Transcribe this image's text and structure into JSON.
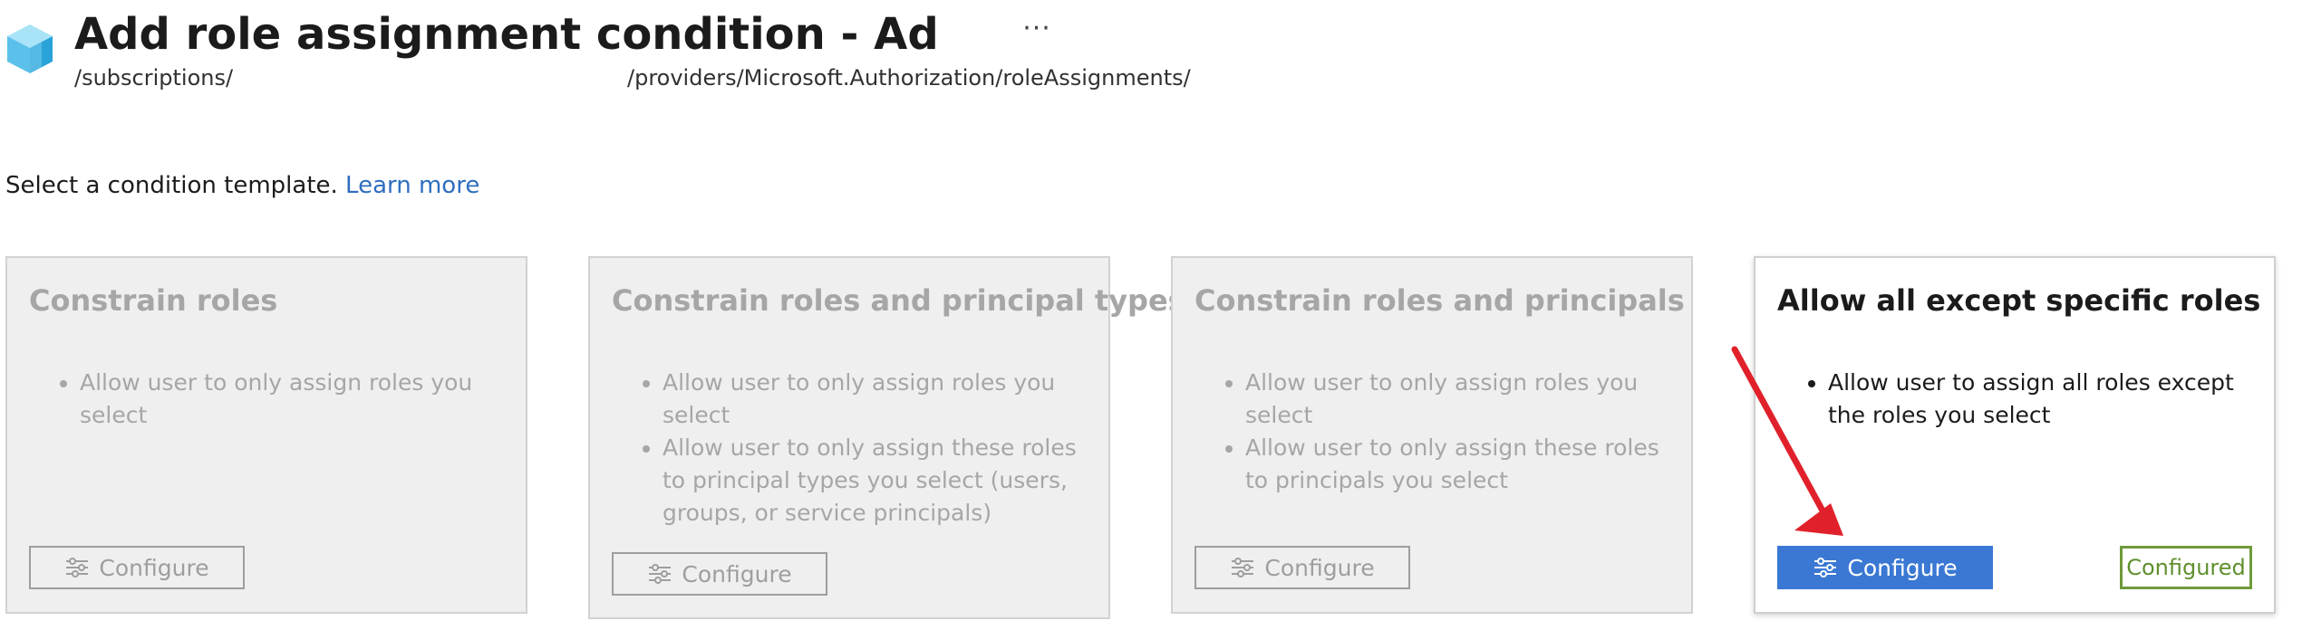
{
  "header": {
    "title": "Add role assignment condition - Ad",
    "more_label": "···",
    "path_left": "/subscriptions/",
    "path_right": "/providers/Microsoft.Authorization/roleAssignments/"
  },
  "intro": {
    "text": "Select a condition template.",
    "link": "Learn more"
  },
  "cards": [
    {
      "title": "Constrain roles",
      "bullets": [
        "Allow user to only assign roles you select"
      ],
      "button_label": "Configure"
    },
    {
      "title": "Constrain roles and principal types",
      "bullets": [
        "Allow user to only assign roles you select",
        "Allow user to only assign these roles to principal types you select (users, groups, or service principals)"
      ],
      "button_label": "Configure"
    },
    {
      "title": "Constrain roles and principals",
      "bullets": [
        "Allow user to only assign roles you select",
        "Allow user to only assign these roles to principals you select"
      ],
      "button_label": "Configure"
    },
    {
      "title": "Allow all except specific roles",
      "bullets": [
        "Allow user to assign all roles except the roles you select"
      ],
      "button_label": "Configure",
      "status": "Configured"
    }
  ],
  "colors": {
    "primary": "#3a78d4",
    "configured": "#5f8f2e",
    "link": "#2f6dbf",
    "annotation_arrow": "#e0212b"
  },
  "icons": {
    "app": "cube-icon",
    "configure": "settings-sliders-icon"
  }
}
